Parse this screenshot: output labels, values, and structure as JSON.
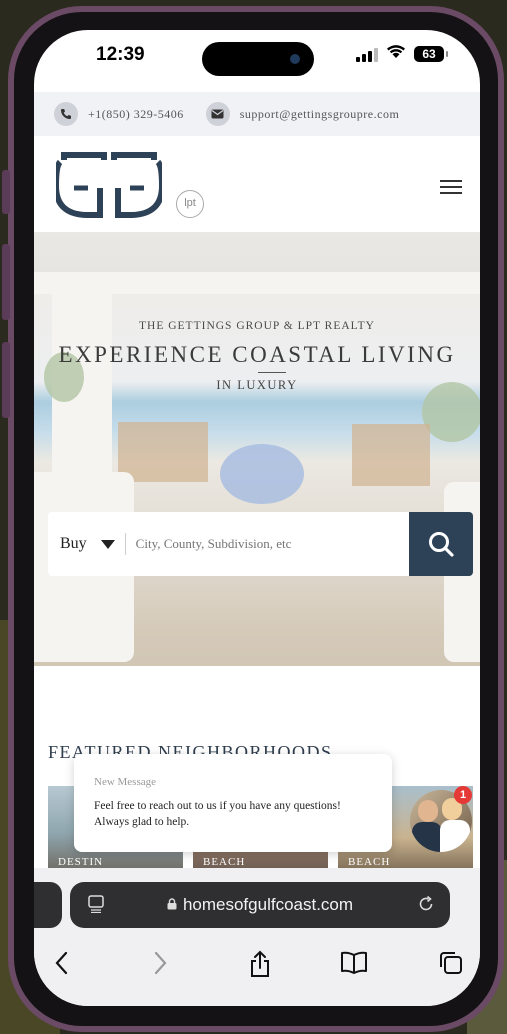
{
  "status": {
    "time": "12:39",
    "battery": "63"
  },
  "contact": {
    "phone": "+1(850) 329-5406",
    "email": "support@gettingsgroupre.com"
  },
  "header": {
    "logo_text": "GG",
    "lpt_text": "lpt"
  },
  "hero": {
    "subtitle": "THE GETTINGS GROUP & LPT REALTY",
    "title": "EXPERIENCE COASTAL LIVING",
    "tagline": "IN LUXURY"
  },
  "search": {
    "mode": "Buy",
    "placeholder": "City, County, Subdivision, etc"
  },
  "featured": {
    "heading": "FEATURED NEIGHBORHOODS",
    "cards": [
      {
        "label": "DESTIN"
      },
      {
        "label": "BEACH"
      },
      {
        "label": "BEACH"
      }
    ]
  },
  "chat": {
    "title": "New Message",
    "message": "Feel free to reach out to us if you have any questions! Always glad to help.",
    "badge": "1"
  },
  "browser": {
    "domain": "homesofgulfcoast.com"
  },
  "colors": {
    "navy": "#2e4257",
    "chat_badge": "#e53935"
  }
}
